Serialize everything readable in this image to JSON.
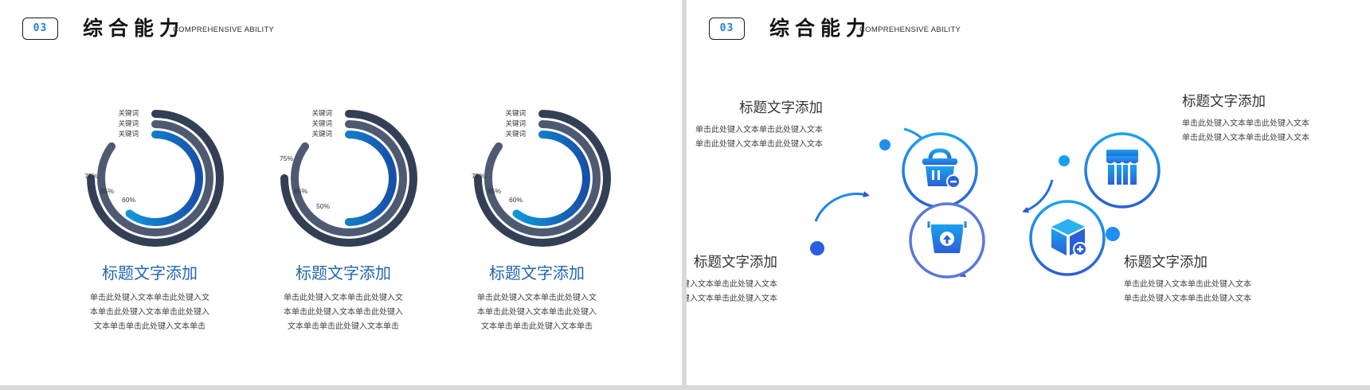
{
  "header": {
    "badge": "03",
    "title": "综合能力",
    "subtitle": "COMPREHENSIVE ABILITY"
  },
  "colors": {
    "dark": "#333f54",
    "mid": "#4d5a72",
    "blue_start": "#0fa6e8",
    "blue_end": "#1650a8",
    "heading_blue": "#2167b0"
  },
  "rings": [
    {
      "labels": [
        "关键词",
        "关键词",
        "关键词"
      ],
      "outer": {
        "percent": 75,
        "label": "75%"
      },
      "middle": {
        "percent": 85,
        "label": "85%"
      },
      "inner": {
        "percent": 60,
        "label": "60%"
      },
      "title": "标题文字添加",
      "desc": [
        "单击此处键入文本单击此处键入文",
        "本单击此处键入文本单击此处键入",
        "文本单击单击此处键入文本单击"
      ]
    },
    {
      "labels": [
        "关键词",
        "关键词",
        "关键词"
      ],
      "outer": {
        "percent": 75,
        "label": "75%"
      },
      "middle": {
        "percent": 85,
        "label": "85%"
      },
      "inner": {
        "percent": 50,
        "label": "50%"
      },
      "title": "标题文字添加",
      "desc": [
        "单击此处键入文本单击此处键入文",
        "本单击此处键入文本单击此处键入",
        "文本单击单击此处键入文本单击"
      ]
    },
    {
      "labels": [
        "关键词",
        "关键词",
        "关键词"
      ],
      "outer": {
        "percent": 75,
        "label": "75%"
      },
      "middle": {
        "percent": 85,
        "label": "85%"
      },
      "inner": {
        "percent": 60,
        "label": "60%"
      },
      "title": "标题文字添加",
      "desc": [
        "单击此处键入文本单击此处键入文",
        "本单击此处键入文本单击此处键入",
        "文本单击单击此处键入文本单击"
      ]
    }
  ],
  "flow": {
    "items": [
      {
        "title": "标题文字添加",
        "desc": [
          "单击此处键入文本单击此处键入文本",
          "单击此处键入文本单击此处键入文本"
        ],
        "icon": "basket-remove-icon"
      },
      {
        "title": "标题文字添加",
        "desc": [
          "单击此处键入文本单击此处键入文本",
          "单击此处键入文本单击此处键入文本"
        ],
        "icon": "storefront-icon"
      },
      {
        "title": "标题文字添加",
        "desc": [
          "单击此处键入文本单击此处键入文本",
          "单击此处键入文本单击此处键入文本"
        ],
        "icon": "basket-upload-icon"
      },
      {
        "title": "标题文字添加",
        "desc": [
          "单击此处键入文本单击此处键入文本",
          "单击此处键入文本单击此处键入文本"
        ],
        "icon": "box-add-icon"
      }
    ]
  }
}
